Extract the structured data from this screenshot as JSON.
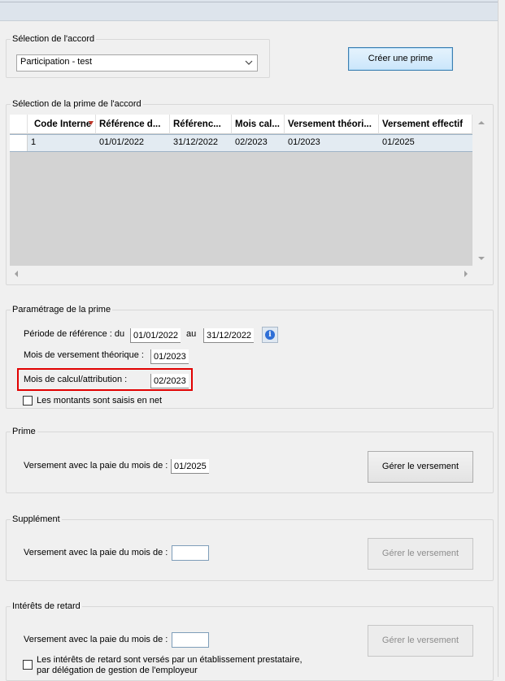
{
  "accord": {
    "legend": "Sélection de l'accord",
    "selected": "Participation - test",
    "create_label": "Créer une prime"
  },
  "prime_accord": {
    "legend": "Sélection de la prime de l'accord",
    "columns": [
      "Code Interne",
      "Référence d...",
      "Référenc...",
      "Mois cal...",
      "Versement théori...",
      "Versement effectif"
    ],
    "rows": [
      [
        "1",
        "01/01/2022",
        "31/12/2022",
        "02/2023",
        "01/2023",
        "01/2025"
      ]
    ]
  },
  "parametrage": {
    "legend": "Paramétrage de la prime",
    "periode_label": "Période de référence : du",
    "date_du": "01/01/2022",
    "au_label": "au",
    "date_au": "31/12/2022",
    "info_glyph": "i",
    "mois_theorique_label": "Mois de versement théorique :",
    "mois_theorique": "01/2023",
    "mois_calcul_label": "Mois de calcul/attribution :",
    "mois_calcul": "02/2023",
    "net_label": "Les montants sont saisis en net"
  },
  "prime": {
    "legend": "Prime",
    "versement_label": "Versement avec la paie du mois de :",
    "versement_value": "01/2025",
    "gerer_label": "Gérer le versement"
  },
  "supplement": {
    "legend": "Supplément",
    "versement_label": "Versement avec la paie du mois de :",
    "versement_value": "",
    "gerer_label": "Gérer le versement"
  },
  "interets": {
    "legend": "Intérêts de retard",
    "versement_label": "Versement avec la paie du mois de :",
    "versement_value": "",
    "gerer_label": "Gérer le versement",
    "checkbox_line1": "Les intérêts de retard sont versés par un établissement prestataire,",
    "checkbox_line2": "par délégation de gestion de l'employeur"
  },
  "colors": {
    "highlight": "#e10000",
    "selected_row": "#e3ebf2",
    "primary_button": "#cbe6fb"
  },
  "icons": [
    "chevron-down-icon",
    "info-icon",
    "scroll-up-icon",
    "scroll-down-icon",
    "scroll-left-icon",
    "scroll-right-icon",
    "sort-indicator-icon"
  ]
}
